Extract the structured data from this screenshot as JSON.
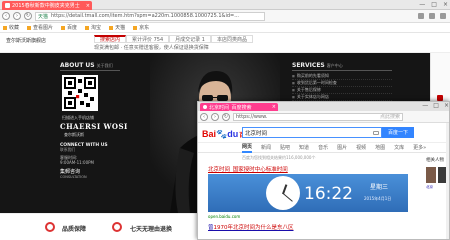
{
  "back_window": {
    "tab_title": "2015春秋新款中腕皮夹克男士",
    "tab_close": "×",
    "win_controls": [
      "—",
      "□",
      "×"
    ],
    "nav": {
      "back": "‹",
      "forward": "›",
      "refresh": "↻"
    },
    "url": "https://detail.tmall.com/item.htm?spm=a220m.1000858.1000725.1&id=...",
    "url_shop": "天猫",
    "bookmarks": [
      "收藏",
      "查看图片",
      "百度",
      "淘宝",
      "天猫",
      "京东"
    ],
    "store": {
      "left_text": "查尔斯沃斯旗舰店",
      "left_sub": "商品",
      "tabs": [
        "搜索店内",
        "月销量 754",
        "评价",
        "保障"
      ],
      "active_tab_index": 0,
      "tab_extra": [
        "累计评价 754",
        "月成交记录 1",
        "本店同类商品"
      ],
      "promo": "现货满包邮 · 任意买赠送客服，使人保证退换货保障"
    },
    "banner": {
      "about_title": "ABOUT US",
      "about_sub": "关于我们",
      "scan_text": "扫描进入手机店铺",
      "brand_en": "CHAERSI WOSI",
      "brand_cn": "查尔斯沃斯",
      "connect_title": "CONNECT WITH US",
      "connect_sub": "联系我们",
      "hours_label": "客服时间:",
      "hours_time": "9:00AM-11:00PM",
      "jpzx": "集郵咨询",
      "jpzx_sub": "CONSULTATION",
      "services_title": "SERVICES",
      "services_sub": "客户中心",
      "services_items": [
        "购买前的先看须知",
        "收到货后第一时间检查",
        "关于售后保修",
        "关于实体店与网店",
        "退换货要求须知",
        "购后商品质量问题须知",
        "本店商品均为正品"
      ]
    },
    "bottom": {
      "item1": "品质保障",
      "item2": "七天无理由退换"
    }
  },
  "front_window": {
    "tab_title": "北京时间_百度搜索",
    "tab_close": "×",
    "win_controls": [
      "—",
      "□",
      "×"
    ],
    "url": "https://www.",
    "url_search_hint": "点此搜索",
    "logo": {
      "bai": "Bai",
      "paw": "🐾",
      "du": "du",
      "cn": "百度"
    },
    "query": "北京时间",
    "search_button": "百度一下",
    "nav_items": [
      "网页",
      "新闻",
      "贴吧",
      "知道",
      "音乐",
      "图片",
      "视频",
      "地图",
      "文库",
      "更多»"
    ],
    "active_nav_index": 0,
    "stats": "百度为您找到相关结果约116,000,000个",
    "result1_title": "北京时间_国家授时中心标准时间",
    "clock": {
      "time": "16:22",
      "weekday": "星期三",
      "date": "2015年4月1日"
    },
    "result1_source": "open.baidu.com",
    "result2_prefix": "曾",
    "result2_title": "1970年北京时间为什么是东八区",
    "side_title": "相关人物",
    "side_caption": "北京"
  }
}
